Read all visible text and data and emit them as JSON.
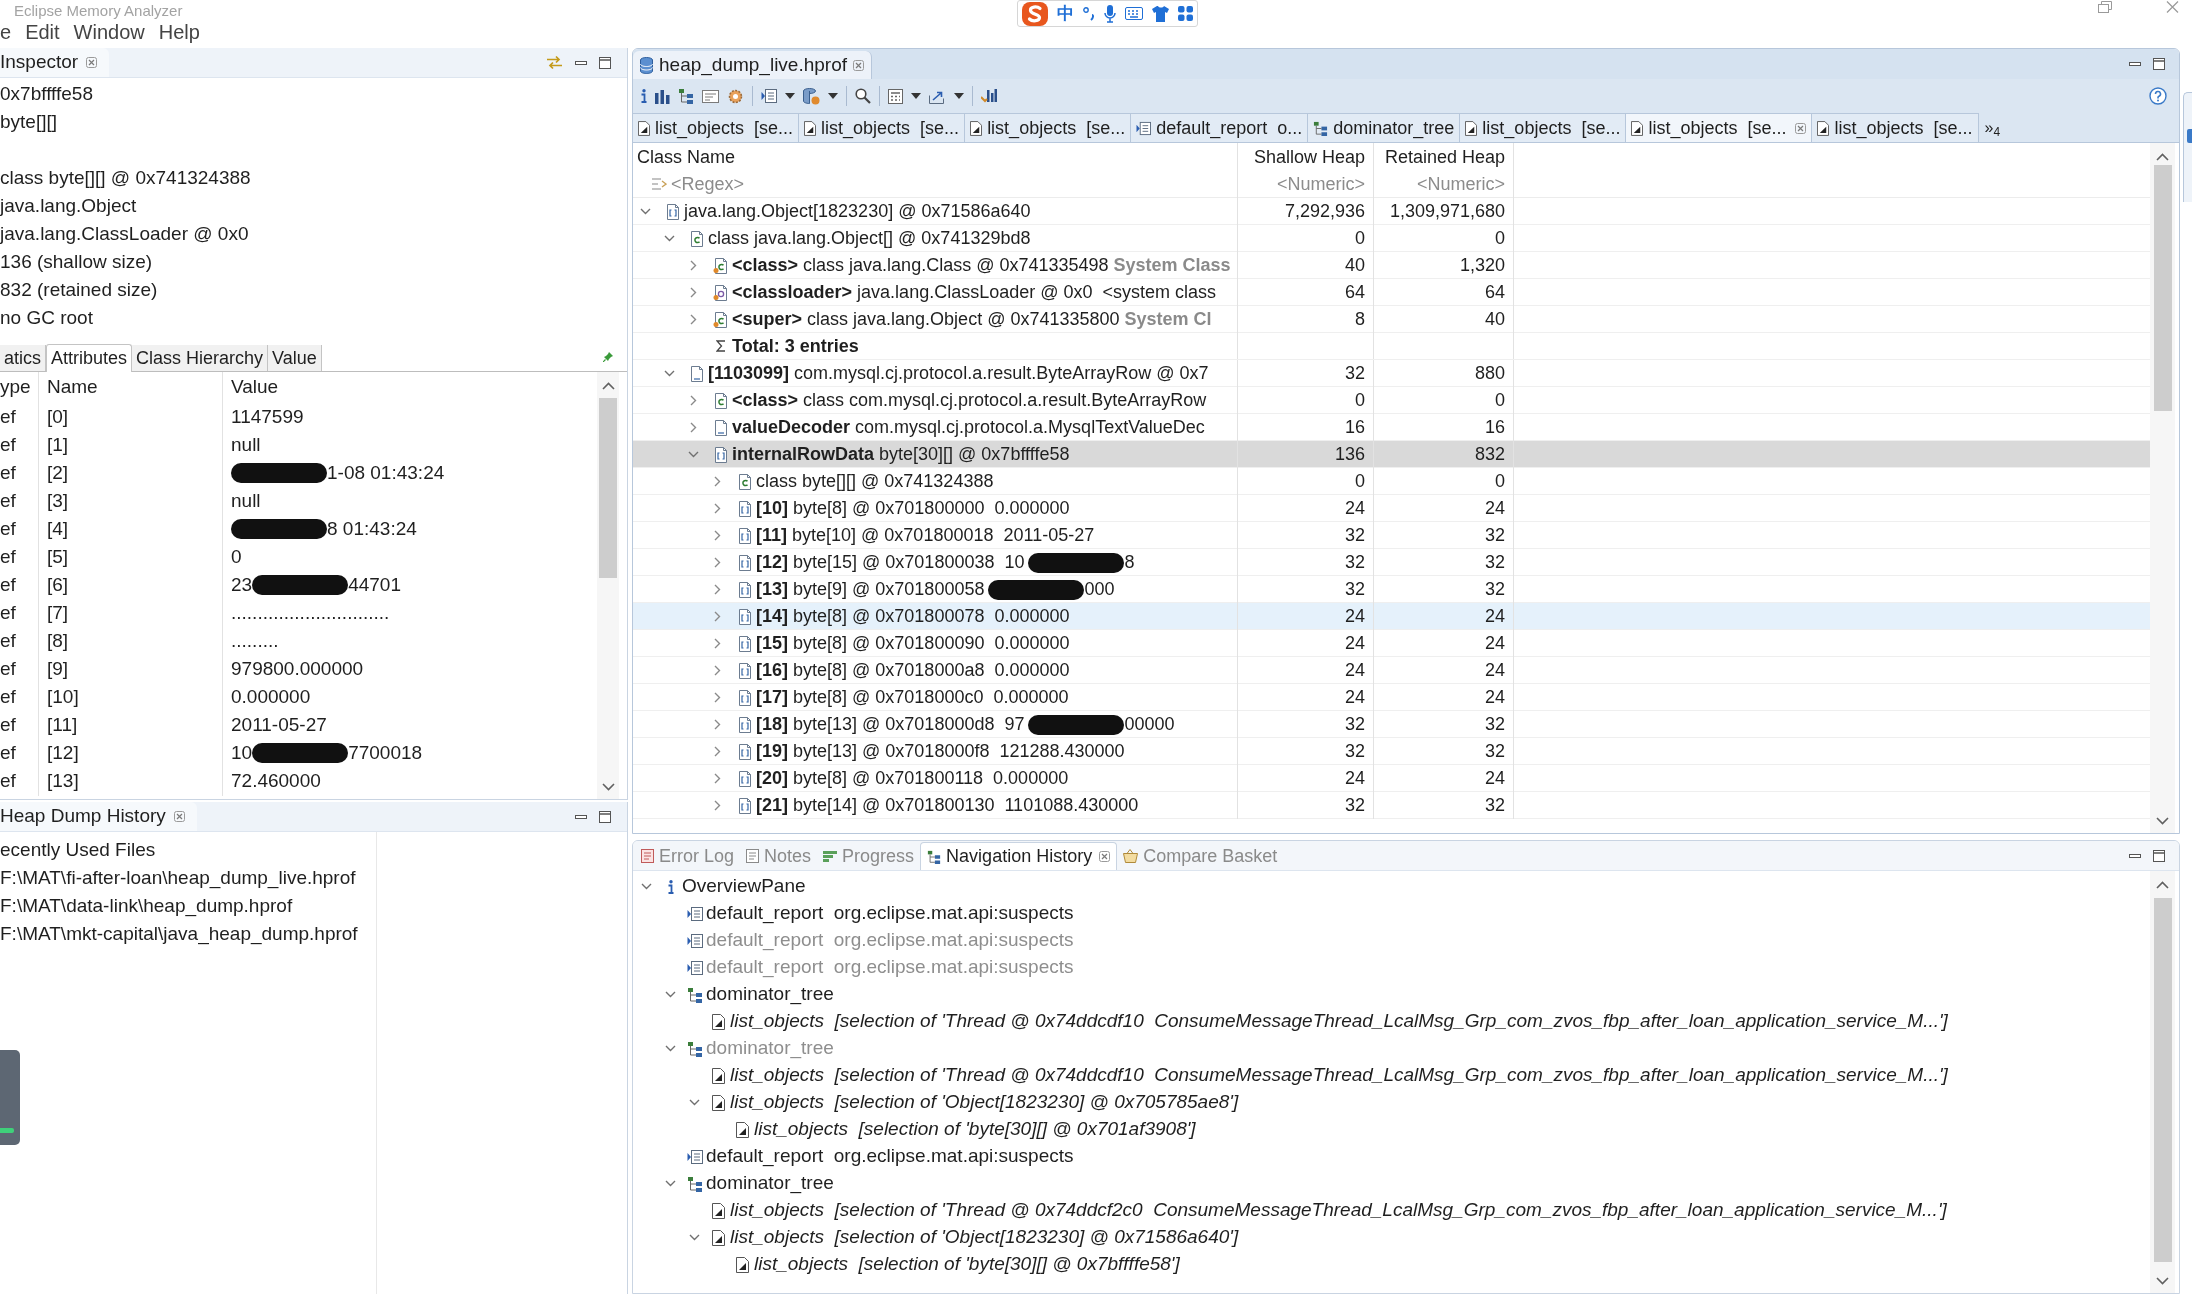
{
  "window": {
    "title": "Eclipse Memory Analyzer"
  },
  "menu": [
    "e",
    "Edit",
    "Window",
    "Help"
  ],
  "ime_toolbar": {
    "mode": "中"
  },
  "inspector": {
    "title": "Inspector",
    "summary": [
      "0x7bffffe58",
      "byte[][]"
    ],
    "details": [
      "class byte[][] @ 0x741324388",
      "java.lang.Object",
      "java.lang.ClassLoader @ 0x0",
      "136 (shallow size)",
      "832 (retained size)",
      "no GC root"
    ],
    "tabs": [
      {
        "label": "atics",
        "selected": false
      },
      {
        "label": "Attributes",
        "selected": true
      },
      {
        "label": "Class Hierarchy",
        "selected": false
      },
      {
        "label": "Value",
        "selected": false
      }
    ],
    "columns": [
      "ype",
      "Name",
      "Value"
    ],
    "rows": [
      {
        "type": "ef",
        "name": "[0]",
        "value": "1147599",
        "redacted": false
      },
      {
        "type": "ef",
        "name": "[1]",
        "value": "null",
        "redacted": false
      },
      {
        "type": "ef",
        "name": "[2]",
        "redacted": true,
        "value_after": "1-08 01:43:24"
      },
      {
        "type": "ef",
        "name": "[3]",
        "value": "null",
        "redacted": false
      },
      {
        "type": "ef",
        "name": "[4]",
        "redacted": true,
        "value_after": "8 01:43:24"
      },
      {
        "type": "ef",
        "name": "[5]",
        "value": "0",
        "redacted": false
      },
      {
        "type": "ef",
        "name": "[6]",
        "value": "23",
        "redacted": true,
        "value_after": "44701"
      },
      {
        "type": "ef",
        "name": "[7]",
        "value": "..............................",
        "redacted": false
      },
      {
        "type": "ef",
        "name": "[8]",
        "value": ".........",
        "redacted": false
      },
      {
        "type": "ef",
        "name": "[9]",
        "value": "979800.000000",
        "redacted": false
      },
      {
        "type": "ef",
        "name": "[10]",
        "value": "0.000000",
        "redacted": false
      },
      {
        "type": "ef",
        "name": "[11]",
        "value": "2011-05-27",
        "redacted": false
      },
      {
        "type": "ef",
        "name": "[12]",
        "value": "10",
        "redacted": true,
        "value_after": "7700018"
      },
      {
        "type": "ef",
        "name": "[13]",
        "value": "72.460000",
        "redacted": false
      }
    ]
  },
  "heap_dump_history": {
    "title": "Heap Dump History",
    "heading": "ecently Used Files",
    "files": [
      "F:\\MAT\\fi-after-loan\\heap_dump_live.hprof",
      "F:\\MAT\\data-link\\heap_dump.hprof",
      "F:\\MAT\\mkt-capital\\java_heap_dump.hprof"
    ]
  },
  "editor": {
    "title": "heap_dump_live.hprof",
    "result_tabs": [
      {
        "kind": "list",
        "label": "list_objects  [se...",
        "selected": false
      },
      {
        "kind": "list",
        "label": "list_objects  [se...",
        "selected": false
      },
      {
        "kind": "list",
        "label": "list_objects  [se...",
        "selected": false
      },
      {
        "kind": "report",
        "label": "default_report  o...",
        "selected": false
      },
      {
        "kind": "tree",
        "label": "dominator_tree",
        "selected": false
      },
      {
        "kind": "list",
        "label": "list_objects  [se...",
        "selected": false
      },
      {
        "kind": "list",
        "label": "list_objects  [se...",
        "selected": true
      },
      {
        "kind": "list",
        "label": "list_objects  [se...",
        "selected": false
      }
    ],
    "tabs_overflow": "»$_{4}$",
    "columns": [
      "Class Name",
      "Shallow Heap",
      "Retained Heap"
    ],
    "filters": [
      "<Regex>",
      "<Numeric>",
      "<Numeric>"
    ],
    "rows": [
      {
        "kind": "array",
        "text": "java.lang.Object[1823230] @ 0x71586a640",
        "shallow": "7,292,936",
        "retained": "1,309,971,680",
        "expanded": true,
        "selected": false,
        "hovered": false,
        "redacted": false,
        "children": [
          {
            "kind": "class",
            "text": "class java.lang.Object[] @ 0x741329bd8",
            "shallow": "0",
            "retained": "0",
            "expanded": true,
            "selected": false,
            "hovered": false,
            "redacted": false,
            "children": [
              {
                "kind": "root_class",
                "text": "**<class>** class java.lang.Class @ 0x741335498",
                "note": "System Class",
                "shallow": "40",
                "retained": "1,320",
                "expanded": false,
                "selected": false,
                "hovered": false,
                "redacted": false
              },
              {
                "kind": "loader",
                "text": "**<classloader>** java.lang.ClassLoader @ 0x0  <system class",
                "shallow": "64",
                "retained": "64",
                "expanded": false,
                "selected": false,
                "hovered": false,
                "redacted": false
              },
              {
                "kind": "root_class",
                "text": "**<super>** class java.lang.Object @ 0x741335800",
                "note": "System Cl",
                "shallow": "8",
                "retained": "40",
                "expanded": false,
                "selected": false,
                "hovered": false,
                "redacted": false
              },
              {
                "kind": "total",
                "text": "Total: 3 entries",
                "selected": false,
                "hovered": false,
                "redacted": false
              }
            ]
          },
          {
            "kind": "object",
            "text": "**[1103099]** com.mysql.cj.protocol.a.result.ByteArrayRow @ 0x7",
            "shallow": "32",
            "retained": "880",
            "expanded": true,
            "selected": false,
            "hovered": false,
            "redacted": false,
            "children": [
              {
                "kind": "class",
                "text": "**<class>** class com.mysql.cj.protocol.a.result.ByteArrayRow",
                "shallow": "0",
                "retained": "0",
                "expanded": false,
                "selected": false,
                "hovered": false,
                "redacted": false
              },
              {
                "kind": "object",
                "text": "**valueDecoder** com.mysql.cj.protocol.a.MysqlTextValueDec",
                "shallow": "16",
                "retained": "16",
                "expanded": false,
                "selected": false,
                "hovered": false,
                "redacted": false
              },
              {
                "kind": "array",
                "text": "**internalRowData** byte[30][] @ 0x7bffffe58",
                "shallow": "136",
                "retained": "832",
                "expanded": true,
                "selected": true,
                "hovered": false,
                "redacted": false,
                "children": [
                  {
                    "kind": "class",
                    "text": "class byte[][] @ 0x741324388",
                    "shallow": "0",
                    "retained": "0",
                    "expanded": false,
                    "selected": false,
                    "hovered": false,
                    "redacted": false
                  },
                  {
                    "kind": "array",
                    "text": "**[10]** byte[8] @ 0x701800000  0.000000",
                    "shallow": "24",
                    "retained": "24",
                    "expanded": false,
                    "selected": false,
                    "hovered": false,
                    "redacted": false
                  },
                  {
                    "kind": "array",
                    "text": "**[11]** byte[10] @ 0x701800018  2011-05-27",
                    "shallow": "32",
                    "retained": "32",
                    "expanded": false,
                    "selected": false,
                    "hovered": false,
                    "redacted": false
                  },
                  {
                    "kind": "array",
                    "text": "**[12]** byte[15] @ 0x701800038  10",
                    "text_after": "8",
                    "shallow": "32",
                    "retained": "32",
                    "expanded": false,
                    "selected": false,
                    "hovered": false,
                    "redacted": true
                  },
                  {
                    "kind": "array",
                    "text": "**[13]** byte[9] @ 0x701800058",
                    "text_after": "000",
                    "shallow": "32",
                    "retained": "32",
                    "expanded": false,
                    "selected": false,
                    "hovered": false,
                    "redacted": true
                  },
                  {
                    "kind": "array",
                    "text": "**[14]** byte[8] @ 0x701800078  0.000000",
                    "shallow": "24",
                    "retained": "24",
                    "expanded": false,
                    "selected": false,
                    "hovered": true,
                    "redacted": false
                  },
                  {
                    "kind": "array",
                    "text": "**[15]** byte[8] @ 0x701800090  0.000000",
                    "shallow": "24",
                    "retained": "24",
                    "expanded": false,
                    "selected": false,
                    "hovered": false,
                    "redacted": false
                  },
                  {
                    "kind": "array",
                    "text": "**[16]** byte[8] @ 0x7018000a8  0.000000",
                    "shallow": "24",
                    "retained": "24",
                    "expanded": false,
                    "selected": false,
                    "hovered": false,
                    "redacted": false
                  },
                  {
                    "kind": "array",
                    "text": "**[17]** byte[8] @ 0x7018000c0  0.000000",
                    "shallow": "24",
                    "retained": "24",
                    "expanded": false,
                    "selected": false,
                    "hovered": false,
                    "redacted": false
                  },
                  {
                    "kind": "array",
                    "text": "**[18]** byte[13] @ 0x7018000d8  97",
                    "text_after": "00000",
                    "shallow": "32",
                    "retained": "32",
                    "expanded": false,
                    "selected": false,
                    "hovered": false,
                    "redacted": true
                  },
                  {
                    "kind": "array",
                    "text": "**[19]** byte[13] @ 0x7018000f8  121288.430000",
                    "shallow": "32",
                    "retained": "32",
                    "expanded": false,
                    "selected": false,
                    "hovered": false,
                    "redacted": false
                  },
                  {
                    "kind": "array",
                    "text": "**[20]** byte[8] @ 0x701800118  0.000000",
                    "shallow": "24",
                    "retained": "24",
                    "expanded": false,
                    "selected": false,
                    "hovered": false,
                    "redacted": false
                  },
                  {
                    "kind": "array",
                    "text": "**[21]** byte[14] @ 0x701800130  1101088.430000",
                    "shallow": "32",
                    "retained": "32",
                    "expanded": false,
                    "selected": false,
                    "hovered": false,
                    "redacted": false
                  }
                ]
              }
            ]
          }
        ]
      }
    ]
  },
  "bottom_panel": {
    "tabs": [
      {
        "kind": "log",
        "label": "Error Log",
        "selected": false
      },
      {
        "kind": "notes",
        "label": "Notes",
        "selected": false
      },
      {
        "kind": "progress",
        "label": "Progress",
        "selected": false
      },
      {
        "kind": "history",
        "label": "Navigation History",
        "selected": true
      },
      {
        "kind": "basket",
        "label": "Compare Basket",
        "selected": false
      }
    ],
    "history": [
      {
        "kind": "overview",
        "text": "OverviewPane",
        "expanded": true,
        "disabled": false,
        "children": [
          {
            "kind": "report",
            "text": "default_report  org.eclipse.mat.api:suspects",
            "disabled": false
          },
          {
            "kind": "report",
            "text": "default_report  org.eclipse.mat.api:suspects",
            "disabled": true
          },
          {
            "kind": "report",
            "text": "default_report  org.eclipse.mat.api:suspects",
            "disabled": true
          },
          {
            "kind": "tree",
            "text": "dominator_tree",
            "expanded": true,
            "disabled": false,
            "children": [
              {
                "kind": "list",
                "text": "list_objects  [selection of 'Thread @ 0x74ddcdf10  ConsumeMessageThread_LcalMsg_Grp_com_zvos_fbp_after_loan_application_service_M...']",
                "disabled": false
              }
            ]
          },
          {
            "kind": "tree",
            "text": "dominator_tree",
            "expanded": true,
            "disabled": true,
            "children": [
              {
                "kind": "list",
                "text": "list_objects  [selection of 'Thread @ 0x74ddcdf10  ConsumeMessageThread_LcalMsg_Grp_com_zvos_fbp_after_loan_application_service_M...']",
                "disabled": false
              },
              {
                "kind": "list",
                "text": "list_objects  [selection of 'Object[1823230] @ 0x705785ae8']",
                "expanded": true,
                "disabled": false,
                "children": [
                  {
                    "kind": "list",
                    "text": "list_objects  [selection of 'byte[30][] @ 0x701af3908']",
                    "disabled": false
                  }
                ]
              }
            ]
          },
          {
            "kind": "report",
            "text": "default_report  org.eclipse.mat.api:suspects",
            "disabled": false
          },
          {
            "kind": "tree",
            "text": "dominator_tree",
            "expanded": true,
            "disabled": false,
            "children": [
              {
                "kind": "list",
                "text": "list_objects  [selection of 'Thread @ 0x74ddcf2c0  ConsumeMessageThread_LcalMsg_Grp_com_zvos_fbp_after_loan_application_service_M...']",
                "disabled": false
              },
              {
                "kind": "list",
                "text": "list_objects  [selection of 'Object[1823230] @ 0x71586a640']",
                "expanded": true,
                "disabled": false,
                "children": [
                  {
                    "kind": "list",
                    "text": "list_objects  [selection of 'byte[30][] @ 0x7bffffe58']",
                    "disabled": false
                  }
                ]
              }
            ]
          }
        ]
      }
    ]
  }
}
